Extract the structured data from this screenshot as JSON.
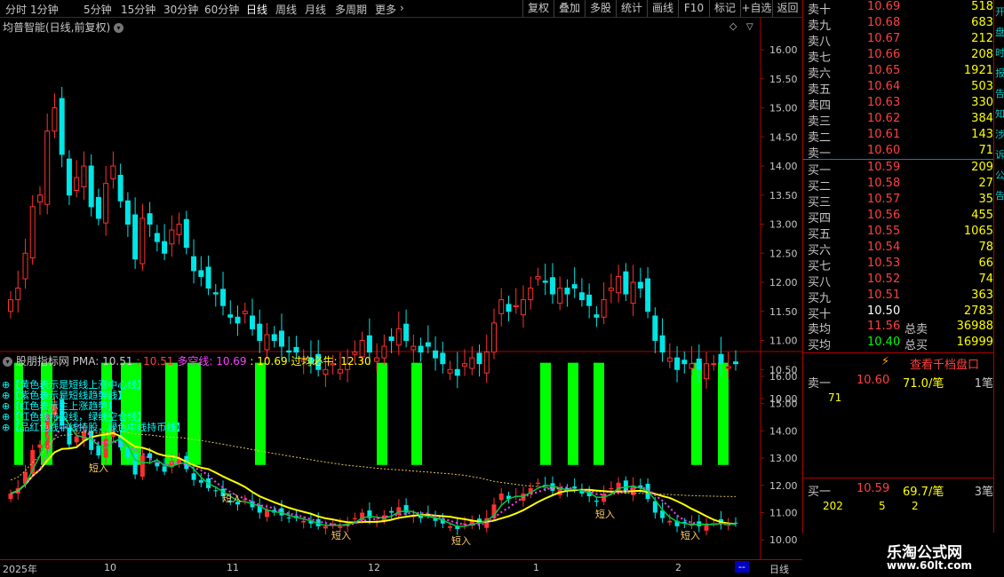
{
  "toolbar": {
    "periods": [
      "分时",
      "1分钟",
      "5分钟",
      "15分钟",
      "30分钟",
      "60分钟",
      "日线",
      "周线",
      "月线",
      "多周期",
      "更多"
    ],
    "active_period": "日线",
    "right_buttons": [
      "复权",
      "叠加",
      "多股",
      "统计",
      "画线",
      "F10",
      "标记",
      "+自选",
      "返回"
    ]
  },
  "main_chart": {
    "title": "均普智能(日线,前复权)",
    "y_ticks": [
      "16.00",
      "15.50",
      "15.00",
      "14.50",
      "14.00",
      "13.50",
      "13.00",
      "12.50",
      "12.00",
      "11.50",
      "11.00",
      "10.50",
      "10.00"
    ]
  },
  "indicator": {
    "name": "股朋指标网",
    "pma_label": "PMA: 10.51",
    "v1": ": 10.51",
    "dkx_label": "多空线: 10.69",
    "v2": ": 10.69",
    "gjbn_label": "过均必牛: 12.30",
    "y_ticks": [
      "16.00",
      "15.00",
      "14.00",
      "13.00",
      "12.00",
      "11.00",
      "10.00"
    ],
    "legend": [
      "【黄色表示是短线上涨中心线】",
      "【紫色表示是短线趋势线】",
      "【红色表示主上涨趋势】",
      "【红色线持股线，绿线空仓线】",
      "【品红色线中线持股，绿色中线持币线】"
    ],
    "signal_label": "短入"
  },
  "date_axis": {
    "labels": [
      "2025年",
      "10",
      "11",
      "12",
      "1",
      "2"
    ],
    "mode": "日线",
    "scroll": "--"
  },
  "order_book": {
    "sells": [
      {
        "label": "卖十",
        "price": "10.69",
        "vol": "518"
      },
      {
        "label": "卖九",
        "price": "10.68",
        "vol": "683"
      },
      {
        "label": "卖八",
        "price": "10.67",
        "vol": "212"
      },
      {
        "label": "卖七",
        "price": "10.66",
        "vol": "208"
      },
      {
        "label": "卖六",
        "price": "10.65",
        "vol": "1921"
      },
      {
        "label": "卖五",
        "price": "10.64",
        "vol": "503"
      },
      {
        "label": "卖四",
        "price": "10.63",
        "vol": "330"
      },
      {
        "label": "卖三",
        "price": "10.62",
        "vol": "384"
      },
      {
        "label": "卖二",
        "price": "10.61",
        "vol": "143"
      },
      {
        "label": "卖一",
        "price": "10.60",
        "vol": "71"
      }
    ],
    "buys": [
      {
        "label": "买一",
        "price": "10.59",
        "vol": "209"
      },
      {
        "label": "买二",
        "price": "10.58",
        "vol": "27"
      },
      {
        "label": "买三",
        "price": "10.57",
        "vol": "35"
      },
      {
        "label": "买四",
        "price": "10.56",
        "vol": "455"
      },
      {
        "label": "买五",
        "price": "10.55",
        "vol": "1065"
      },
      {
        "label": "买六",
        "price": "10.54",
        "vol": "78"
      },
      {
        "label": "买七",
        "price": "10.53",
        "vol": "66"
      },
      {
        "label": "买八",
        "price": "10.52",
        "vol": "74"
      },
      {
        "label": "买九",
        "price": "10.51",
        "vol": "363"
      },
      {
        "label": "买十",
        "price": "10.50",
        "vol": "2783"
      }
    ],
    "sell_avg": {
      "label": "卖均",
      "price": "11.56",
      "total_label": "总卖",
      "total": "36988"
    },
    "buy_avg": {
      "label": "买均",
      "price": "10.40",
      "total_label": "总买",
      "total": "16999"
    }
  },
  "depth_panel": {
    "button": "查看千档盘口",
    "sell1": {
      "label": "卖一",
      "price": "10.60",
      "avg": "71.0/笔",
      "count": "1笔",
      "orders": [
        "71"
      ]
    },
    "buy1": {
      "label": "买一",
      "price": "10.59",
      "avg": "69.7/笔",
      "count": "3笔",
      "orders": [
        "202",
        "5",
        "2"
      ]
    }
  },
  "side_text": [
    "开",
    "盘",
    "时",
    "报",
    "告",
    "知",
    "涉",
    "诉",
    "公",
    "告"
  ],
  "watermark": {
    "line1": "乐淘公式网",
    "line2": "www.60lt.com"
  },
  "colors": {
    "up": "#ff3030",
    "down": "#00e5e5",
    "bg": "#000000",
    "grid": "#b00000",
    "accent": "#ffff00",
    "bar": "#00ff00"
  }
}
